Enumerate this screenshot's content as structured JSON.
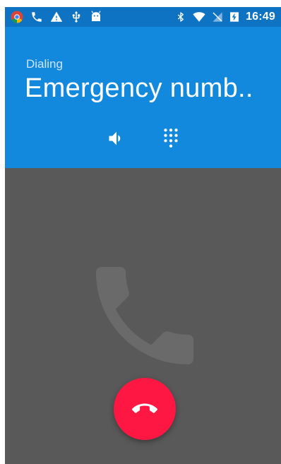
{
  "status_bar": {
    "time": "16:49",
    "left_icons": [
      "chrome-icon",
      "phone-icon",
      "warning-icon",
      "usb-icon",
      "android-icon"
    ],
    "right_icons": [
      "bluetooth-icon",
      "wifi-icon",
      "no-signal-icon",
      "battery-charging-icon"
    ],
    "color": "#0f73c4"
  },
  "call": {
    "state": "Dialing",
    "caller": "Emergency numb..",
    "header_color": "#1289dd",
    "background_color": "#595959"
  },
  "controls": {
    "speaker_icon": "speaker-icon",
    "dialpad_icon": "dialpad-icon",
    "end_call_icon": "hang-up-icon",
    "end_call_color": "#ff1744"
  }
}
